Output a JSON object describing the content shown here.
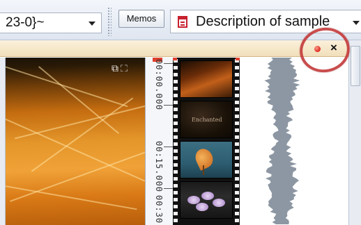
{
  "toolbar": {
    "left_combo_value": "23-0}~",
    "memos_label": "Memos",
    "description_value": "Description of sample",
    "document_icon": "document-icon"
  },
  "panel": {
    "record_indicator_icon": "red-dot-icon",
    "close_label": "×"
  },
  "video": {
    "icons": "⧉ ⛶",
    "popout_icon": "popout-icon",
    "fullscreen_icon": "fullscreen-icon"
  },
  "timeline": {
    "timecodes": [
      "00:00.000",
      "00:15.000",
      "00:30"
    ]
  },
  "film_strip": {
    "frame_caption": "Enchanted"
  },
  "colors": {
    "accent_red": "#e0412e",
    "panel_header": "#f6e7c6",
    "annotation_ring": "#c43a3a"
  }
}
